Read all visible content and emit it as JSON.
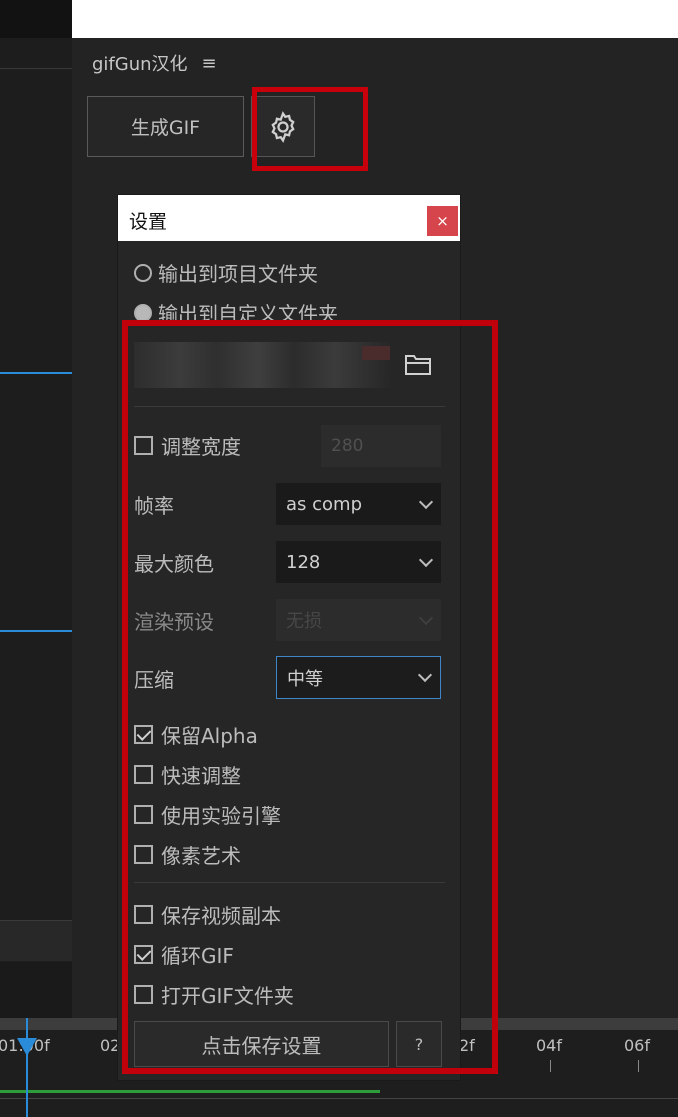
{
  "panel": {
    "title": "gifGun汉化",
    "menu_icon": "hamburger-icon",
    "generate_button": "生成GIF",
    "settings_icon": "gear-icon"
  },
  "dialog": {
    "title": "设置",
    "close_label": "×",
    "radio_project_folder": "输出到项目文件夹",
    "radio_custom_folder": "输出到自定义文件夹",
    "output_mode": "custom",
    "folder_icon": "folder-icon",
    "adjust_width_label": "调整宽度",
    "adjust_width_checked": false,
    "width_value": "280",
    "framerate_label": "帧率",
    "framerate_value": "as comp",
    "max_colors_label": "最大颜色",
    "max_colors_value": "128",
    "render_preset_label": "渲染预设",
    "render_preset_value": "无损",
    "compression_label": "压缩",
    "compression_value": "中等",
    "keep_alpha_label": "保留Alpha",
    "keep_alpha_checked": true,
    "fast_resize_label": "快速调整",
    "fast_resize_checked": false,
    "experimental_engine_label": "使用实验引擎",
    "experimental_engine_checked": false,
    "pixel_art_label": "像素艺术",
    "pixel_art_checked": false,
    "save_video_copy_label": "保存视频副本",
    "save_video_copy_checked": false,
    "loop_gif_label": "循环GIF",
    "loop_gif_checked": true,
    "open_gif_folder_label": "打开GIF文件夹",
    "open_gif_folder_checked": false,
    "save_button": "点击保存设置",
    "help_button": "?"
  },
  "timeline": {
    "ticks": [
      "01:00f",
      "02",
      "2f",
      "04f",
      "06f"
    ]
  },
  "colors": {
    "highlight": "#c0000a",
    "accent_blue": "#2a8bd8",
    "close_red": "#d6454b"
  }
}
